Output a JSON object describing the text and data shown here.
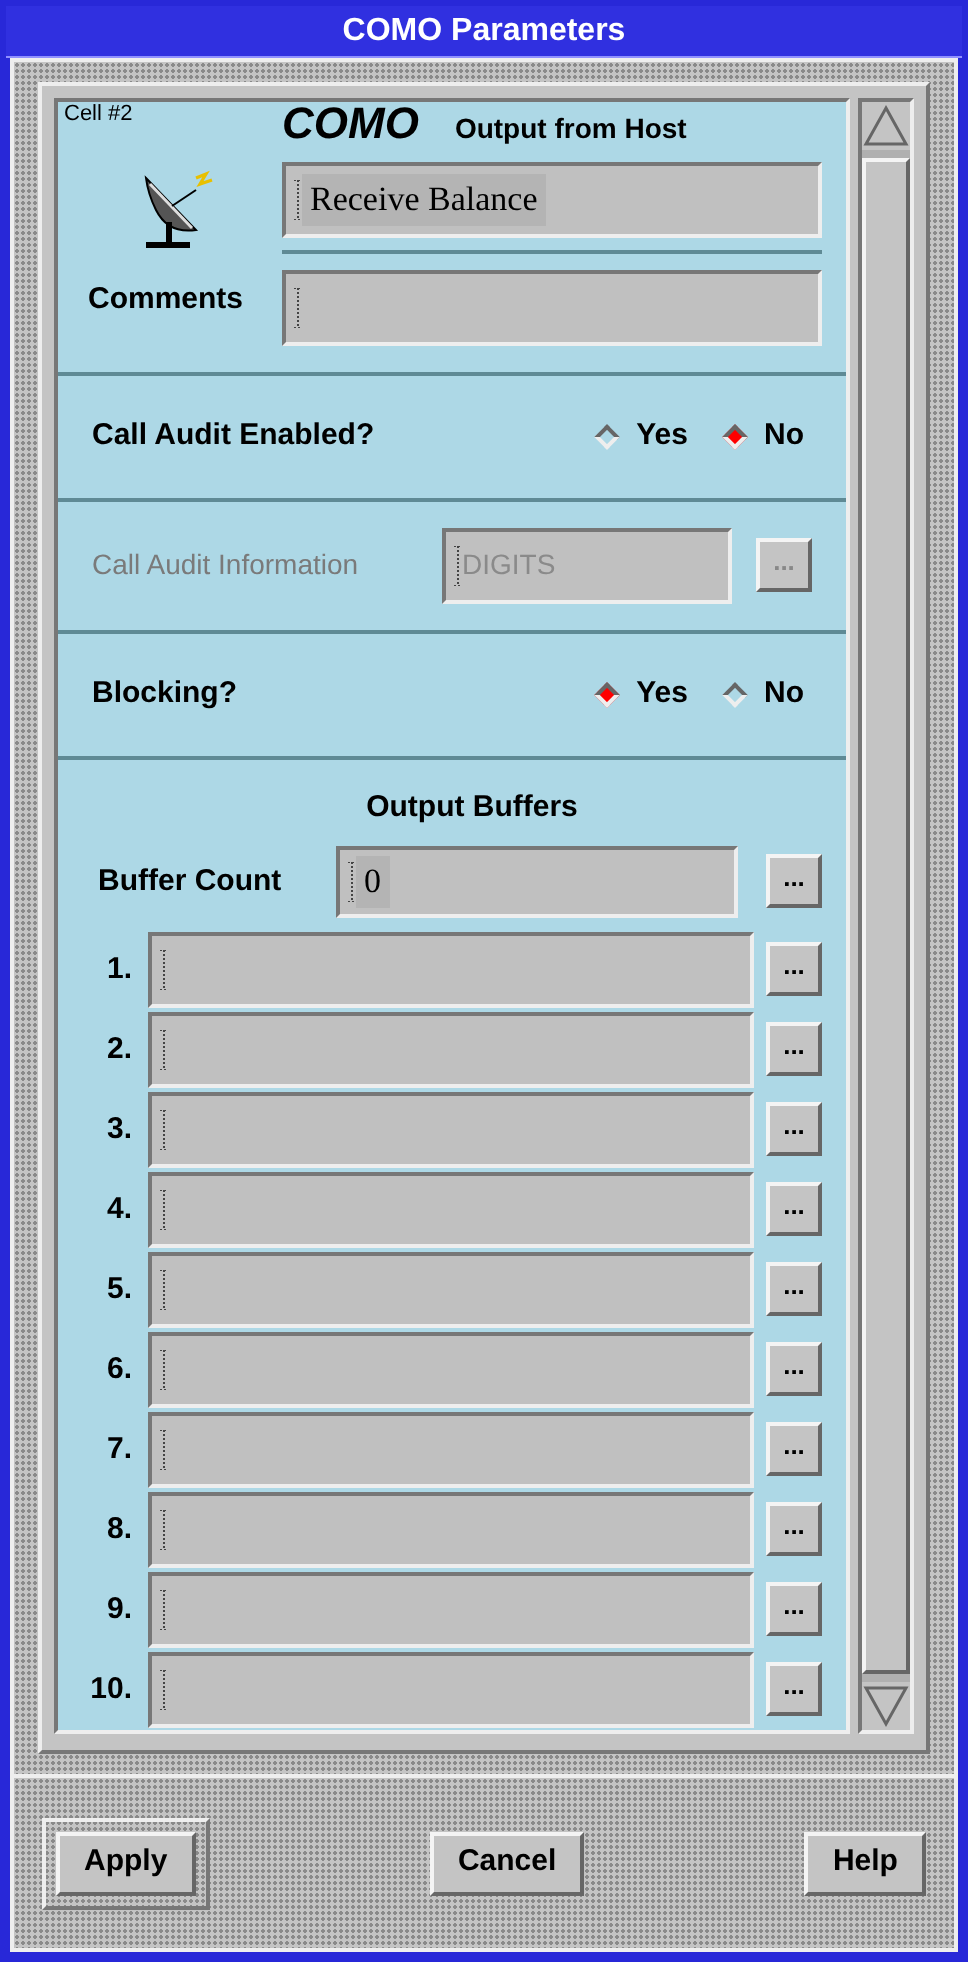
{
  "window": {
    "title": "COMO Parameters"
  },
  "header": {
    "cell_label": "Cell #2",
    "title": "COMO",
    "subtitle": "Output from Host",
    "name_value": "Receive Balance",
    "comments_label": "Comments"
  },
  "call_audit": {
    "label": "Call Audit Enabled?",
    "options": [
      {
        "label": "Yes",
        "selected": false
      },
      {
        "label": "No",
        "selected": true
      }
    ]
  },
  "call_audit_info": {
    "label": "Call Audit Information",
    "value": "DIGITS",
    "disabled": true,
    "button": "..."
  },
  "blocking": {
    "label": "Blocking?",
    "options": [
      {
        "label": "Yes",
        "selected": true
      },
      {
        "label": "No",
        "selected": false
      }
    ]
  },
  "output_buffers": {
    "title": "Output Buffers",
    "count_label": "Buffer Count",
    "count_value": "0",
    "count_button": "...",
    "rows": [
      {
        "label": "1.",
        "button": "..."
      },
      {
        "label": "2.",
        "button": "..."
      },
      {
        "label": "3.",
        "button": "..."
      },
      {
        "label": "4.",
        "button": "..."
      },
      {
        "label": "5.",
        "button": "..."
      },
      {
        "label": "6.",
        "button": "..."
      },
      {
        "label": "7.",
        "button": "..."
      },
      {
        "label": "8.",
        "button": "..."
      },
      {
        "label": "9.",
        "button": "..."
      },
      {
        "label": "10.",
        "button": "..."
      }
    ]
  },
  "buttons": [
    {
      "label": "Apply",
      "default": true
    },
    {
      "label": "Cancel",
      "default": false
    },
    {
      "label": "Help",
      "default": false
    }
  ]
}
